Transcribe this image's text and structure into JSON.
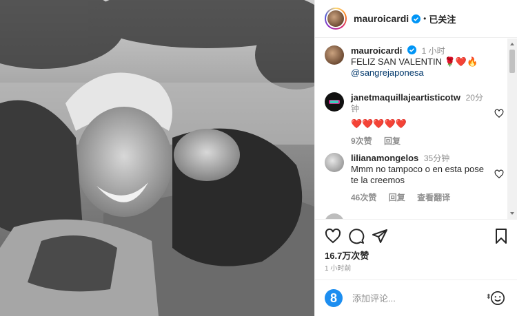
{
  "post": {
    "username": "mauroicardi",
    "follow_state": "已关注",
    "caption_time": "1 小时",
    "caption_text": "FELIZ SAN VALENTIN",
    "caption_emoji": "🌹❤️🔥",
    "caption_mention": "@sangrejaponesa"
  },
  "comments": [
    {
      "username": "janetmaquillajeartisticotw",
      "time": "20分钟",
      "text": "❤️❤️❤️❤️❤️",
      "likes": "9次赞",
      "reply": "回复"
    },
    {
      "username": "lilianamongelos",
      "time": "35分钟",
      "text": "Mmm no tampoco o en esta pose te la creemos",
      "likes": "46次赞",
      "reply": "回复",
      "translate": "查看翻译"
    }
  ],
  "stats": {
    "likes": "16.7万次赞",
    "posted": "1 小时前"
  },
  "composer": {
    "placeholder": "添加评论...",
    "badge": "8"
  },
  "icons": {
    "verified": "verified-badge-icon",
    "like": "heart-icon",
    "comment": "comment-icon",
    "share": "paper-plane-icon",
    "save": "bookmark-icon",
    "emoji": "smiley-icon"
  },
  "colors": {
    "verified": "#0095f6",
    "link": "#00376b",
    "muted": "#8e8e8e",
    "badge": "#1d8ef0"
  }
}
